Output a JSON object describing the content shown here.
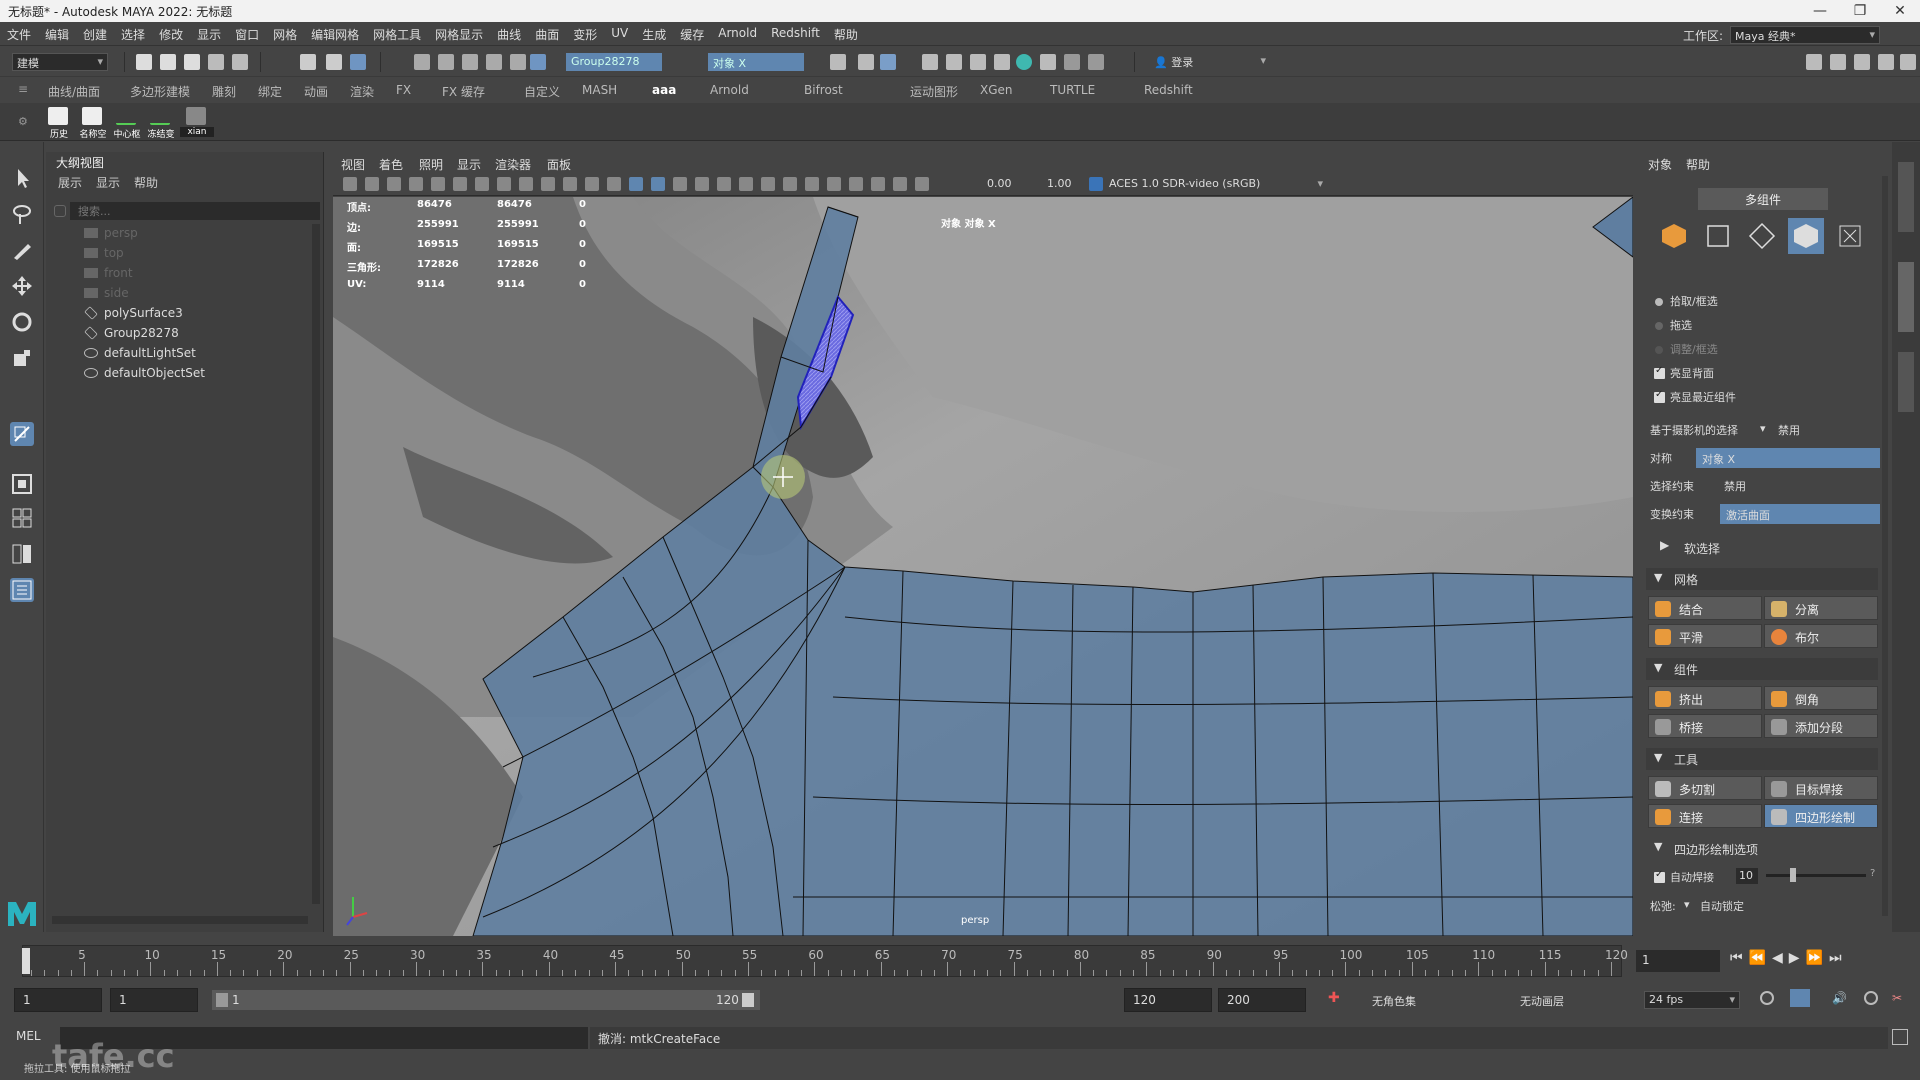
{
  "window": {
    "title": "无标题* - Autodesk MAYA 2022: 无标题",
    "controls": [
      "—",
      "❐",
      "✕"
    ]
  },
  "menubar": {
    "items": [
      "文件",
      "编辑",
      "创建",
      "选择",
      "修改",
      "显示",
      "窗口",
      "网格",
      "编辑网格",
      "网格工具",
      "网格显示",
      "曲线",
      "曲面",
      "变形",
      "UV",
      "生成",
      "缓存",
      "Arnold",
      "Redshift",
      "帮助"
    ],
    "workspace_label": "工作区:",
    "workspace_value": "Maya 经典*"
  },
  "statusline": {
    "mode_menu": "建模",
    "selection_field": "Group28278",
    "name_field": "对象 X",
    "login": "登录"
  },
  "shelf": {
    "tabs": [
      "曲线/曲面",
      "多边形建模",
      "雕刻",
      "绑定",
      "动画",
      "渲染",
      "FX",
      "FX 缓存",
      "自定义",
      "MASH",
      "aaa",
      "Arnold",
      "Bifrost",
      "运动图形",
      "XGen",
      "TURTLE",
      "Redshift"
    ],
    "active_tab": "aaa",
    "buttons": [
      "历史",
      "名称空",
      "中心枢",
      "冻结变",
      "xian"
    ]
  },
  "outliner": {
    "title": "大纲视图",
    "menu": [
      "展示",
      "显示",
      "帮助"
    ],
    "search_placeholder": "搜索...",
    "items": [
      {
        "label": "persp",
        "kind": "camera",
        "dim": true
      },
      {
        "label": "top",
        "kind": "camera",
        "dim": true
      },
      {
        "label": "front",
        "kind": "camera",
        "dim": true
      },
      {
        "label": "side",
        "kind": "camera",
        "dim": true
      },
      {
        "label": "polySurface3",
        "kind": "mesh",
        "dim": false
      },
      {
        "label": "Group28278",
        "kind": "mesh",
        "dim": false
      },
      {
        "label": "defaultLightSet",
        "kind": "set",
        "dim": false
      },
      {
        "label": "defaultObjectSet",
        "kind": "set",
        "dim": false
      }
    ]
  },
  "viewport": {
    "menu": [
      "视图",
      "着色",
      "照明",
      "显示",
      "渲染器",
      "面板"
    ],
    "exposure": "0.00",
    "gamma": "1.00",
    "color_space": "ACES 1.0 SDR-video (sRGB)",
    "camera_label": "persp",
    "object_label": "对象 对象 X",
    "hud": [
      {
        "label": "顶点:",
        "a": "86476",
        "b": "86476",
        "c": "0"
      },
      {
        "label": "边:",
        "a": "255991",
        "b": "255991",
        "c": "0"
      },
      {
        "label": "面:",
        "a": "169515",
        "b": "169515",
        "c": "0"
      },
      {
        "label": "三角形:",
        "a": "172826",
        "b": "172826",
        "c": "0"
      },
      {
        "label": "UV:",
        "a": "9114",
        "b": "9114",
        "c": "0"
      }
    ]
  },
  "modeling_toolkit": {
    "menu": [
      "对象",
      "帮助"
    ],
    "mode_button": "多组件",
    "pick_options": [
      "拾取/框选",
      "拖选",
      "调整/框选"
    ],
    "check_backface": "亮显背面",
    "check_nearest": "亮显最近组件",
    "camera_selection_label": "基于摄影机的选择",
    "camera_selection_value": "禁用",
    "symmetry_label": "对称",
    "symmetry_value": "对象 X",
    "select_constraint_label": "选择约束",
    "select_constraint_value": "禁用",
    "transform_constraint_label": "变换约束",
    "transform_constraint_value": "激活曲面",
    "soft_select": "软选择",
    "sections": {
      "mesh": {
        "title": "网格",
        "buttons": [
          "结合",
          "分离",
          "平滑",
          "布尔"
        ]
      },
      "components": {
        "title": "组件",
        "buttons": [
          "挤出",
          "倒角",
          "桥接",
          "添加分段"
        ]
      },
      "tools": {
        "title": "工具",
        "buttons": [
          "多切割",
          "目标焊接",
          "连接",
          "四边形绘制"
        ]
      }
    },
    "quad_draw_options": "四边形绘制选项",
    "auto_weld_label": "自动焊接",
    "auto_weld_value": "10",
    "relax_label": "松弛:",
    "relax_value": "自动锁定"
  },
  "timeline": {
    "ticks": [
      "5",
      "10",
      "15",
      "20",
      "25",
      "30",
      "35",
      "40",
      "45",
      "50",
      "55",
      "60",
      "65",
      "70",
      "75",
      "80",
      "85",
      "90",
      "95",
      "100",
      "105",
      "110",
      "115",
      "120"
    ],
    "current_frame": "1",
    "start_frame": "1"
  },
  "range": {
    "start": "1",
    "start2": "1",
    "slider_start": "1",
    "slider_end": "120",
    "end": "120",
    "end2": "200",
    "character_set": "无角色集",
    "anim_layer": "无动画层",
    "fps": "24 fps"
  },
  "commandline": {
    "lang": "MEL",
    "result": "撤消: mtkCreateFace",
    "help": "拖拉工具: 使用鼠标拖拉",
    "watermark": "tafe.cc"
  },
  "colors": {
    "accent": "#5f86b0",
    "mesh_blue": "#5f7ea0",
    "selection": "#5555dd",
    "bg": "#444444"
  }
}
